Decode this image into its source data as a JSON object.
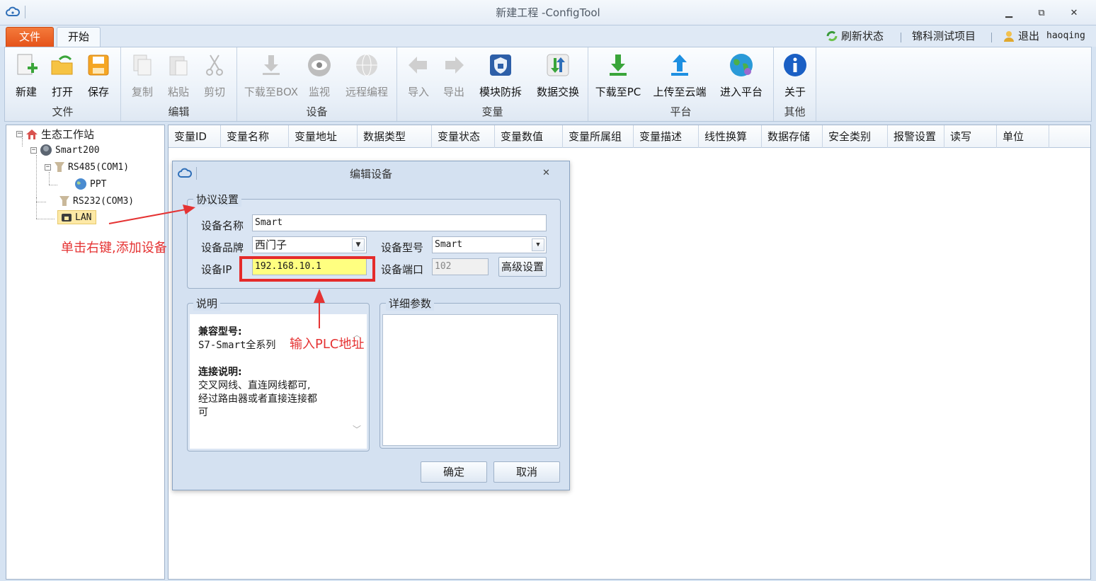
{
  "window": {
    "title": "新建工程 -ConfigTool"
  },
  "tabs": {
    "file": "文件",
    "start": "开始"
  },
  "tabbar_right": {
    "refresh": "刷新状态",
    "project": "锦科测试项目",
    "exit": "退出",
    "user": "haoqing"
  },
  "ribbon": {
    "groups": {
      "file": "文件",
      "edit": "编辑",
      "device": "设备",
      "variable": "变量",
      "platform": "平台",
      "other": "其他"
    },
    "buttons": {
      "new": "新建",
      "open": "打开",
      "save": "保存",
      "copy": "复制",
      "paste": "粘贴",
      "cut": "剪切",
      "download_box": "下载至BOX",
      "monitor": "监视",
      "remote_program": "远程编程",
      "import": "导入",
      "export": "导出",
      "module_protect": "模块防拆",
      "data_exchange": "数据交换",
      "download_pc": "下载至PC",
      "upload_cloud": "上传至云端",
      "enter_platform": "进入平台",
      "about": "关于"
    }
  },
  "tree": {
    "root": "生态工作站",
    "device": "Smart200",
    "rs485": "RS485(COM1)",
    "ppt": "PPT",
    "rs232": "RS232(COM3)",
    "lan": "LAN"
  },
  "grid": {
    "columns": [
      "变量ID",
      "变量名称",
      "变量地址",
      "数据类型",
      "变量状态",
      "变量数值",
      "变量所属组",
      "变量描述",
      "线性换算",
      "数据存储",
      "安全类别",
      "报警设置",
      "读写",
      "单位"
    ]
  },
  "dialog": {
    "title": "编辑设备",
    "protocol_legend": "协议设置",
    "name_label": "设备名称",
    "name_value": "Smart",
    "brand_label": "设备品牌",
    "brand_value": "西门子",
    "model_label": "设备型号",
    "model_value": "Smart",
    "ip_label": "设备IP",
    "ip_value": "192.168.10.1",
    "port_label": "设备端口",
    "port_value": "102",
    "advanced": "高级设置",
    "desc_legend": "说明",
    "desc_compat_title": "兼容型号:",
    "desc_compat_value": "S7-Smart全系列",
    "desc_conn_title": "连接说明:",
    "desc_conn_value": "交叉网线、直连网线都可,\n经过路由器或者直接连接都\n可",
    "detail_legend": "详细参数",
    "ok": "确定",
    "cancel": "取消"
  },
  "annotations": {
    "right_click": "单击右键,添加设备",
    "input_ip": "输入PLC地址"
  },
  "colors": {
    "accent_orange": "#e5531a",
    "annotation_red": "#e53333",
    "ip_highlight": "#ffff80"
  }
}
